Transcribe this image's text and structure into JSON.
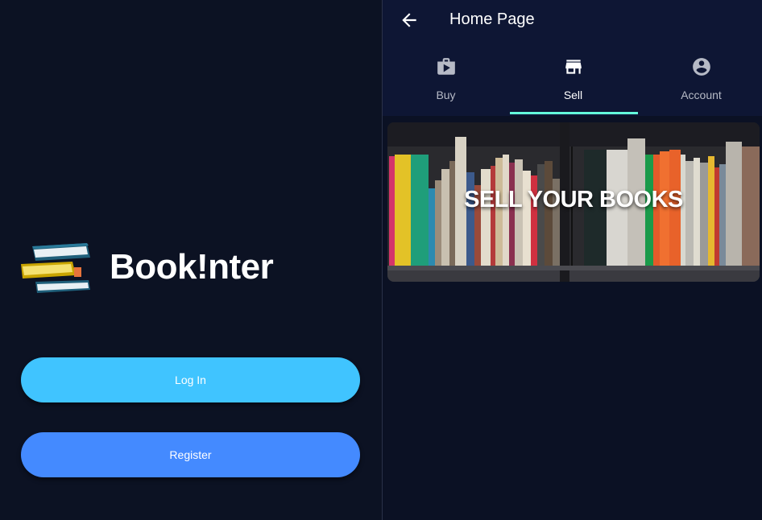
{
  "login_screen": {
    "brand": "Book!nter",
    "login_label": "Log In",
    "register_label": "Register"
  },
  "home_screen": {
    "title": "Home Page",
    "tabs": [
      {
        "label": "Buy",
        "icon": "shop-bag-icon",
        "active": false
      },
      {
        "label": "Sell",
        "icon": "store-icon",
        "active": true
      },
      {
        "label": "Account",
        "icon": "account-circle-icon",
        "active": false
      }
    ],
    "banner_text": "SELL YOUR BOOKS"
  },
  "colors": {
    "background": "#0b1124",
    "appbar": "#0e1634",
    "login_button": "#40c4ff",
    "register_button": "#448aff",
    "tab_indicator": "#64ffda"
  }
}
